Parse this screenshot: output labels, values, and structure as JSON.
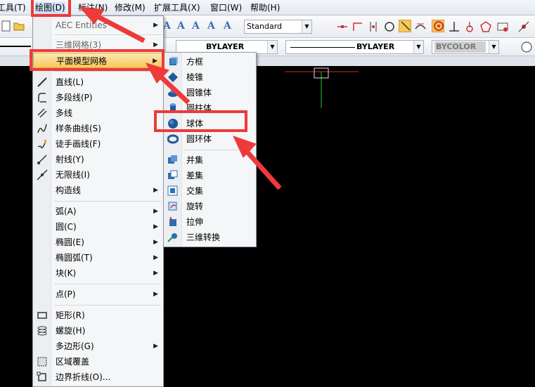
{
  "menubar": {
    "items": [
      {
        "label": "工具(T)"
      },
      {
        "label": "绘图(D)"
      },
      {
        "label": "标注(N)"
      },
      {
        "label": "修改(M)"
      },
      {
        "label": "扩展工具(X)"
      },
      {
        "label": "窗口(W)"
      },
      {
        "label": "帮助(H)"
      }
    ]
  },
  "toolbar": {
    "text_style": "Standard",
    "layer_linetype": "BYLAYER",
    "layer_lineweight": "BYLAYER",
    "color": "BYCOLOR"
  },
  "draw_menu": {
    "items": [
      {
        "label": "AEC Entities"
      },
      {
        "label": "三维网格(3)"
      },
      {
        "label": "平面模型网格"
      },
      {
        "label": "直线(L)"
      },
      {
        "label": "多段线(P)"
      },
      {
        "label": "多线"
      },
      {
        "label": "样条曲线(S)"
      },
      {
        "label": "徒手画线(F)"
      },
      {
        "label": "射线(Y)"
      },
      {
        "label": "无限线(I)"
      },
      {
        "label": "构造线"
      },
      {
        "label": "弧(A)"
      },
      {
        "label": "圆(C)"
      },
      {
        "label": "椭圆(E)"
      },
      {
        "label": "椭圆弧(T)"
      },
      {
        "label": "块(K)"
      },
      {
        "label": "点(P)"
      },
      {
        "label": "矩形(R)"
      },
      {
        "label": "螺旋(H)"
      },
      {
        "label": "多边形(G)"
      },
      {
        "label": "区域覆盖"
      },
      {
        "label": "边界折线(O)..."
      }
    ]
  },
  "submenu": {
    "items": [
      {
        "label": "方框"
      },
      {
        "label": "棱锥"
      },
      {
        "label": "圆锥体"
      },
      {
        "label": "圆柱体"
      },
      {
        "label": "球体"
      },
      {
        "label": "圆环体"
      },
      {
        "label": "并集"
      },
      {
        "label": "差集"
      },
      {
        "label": "交集"
      },
      {
        "label": "旋转"
      },
      {
        "label": "拉伸"
      },
      {
        "label": "三维转换"
      }
    ]
  },
  "colors": {
    "highlight": "#ee3a3a",
    "menu_hover": "#f7c75a",
    "canvas": "#000000"
  }
}
